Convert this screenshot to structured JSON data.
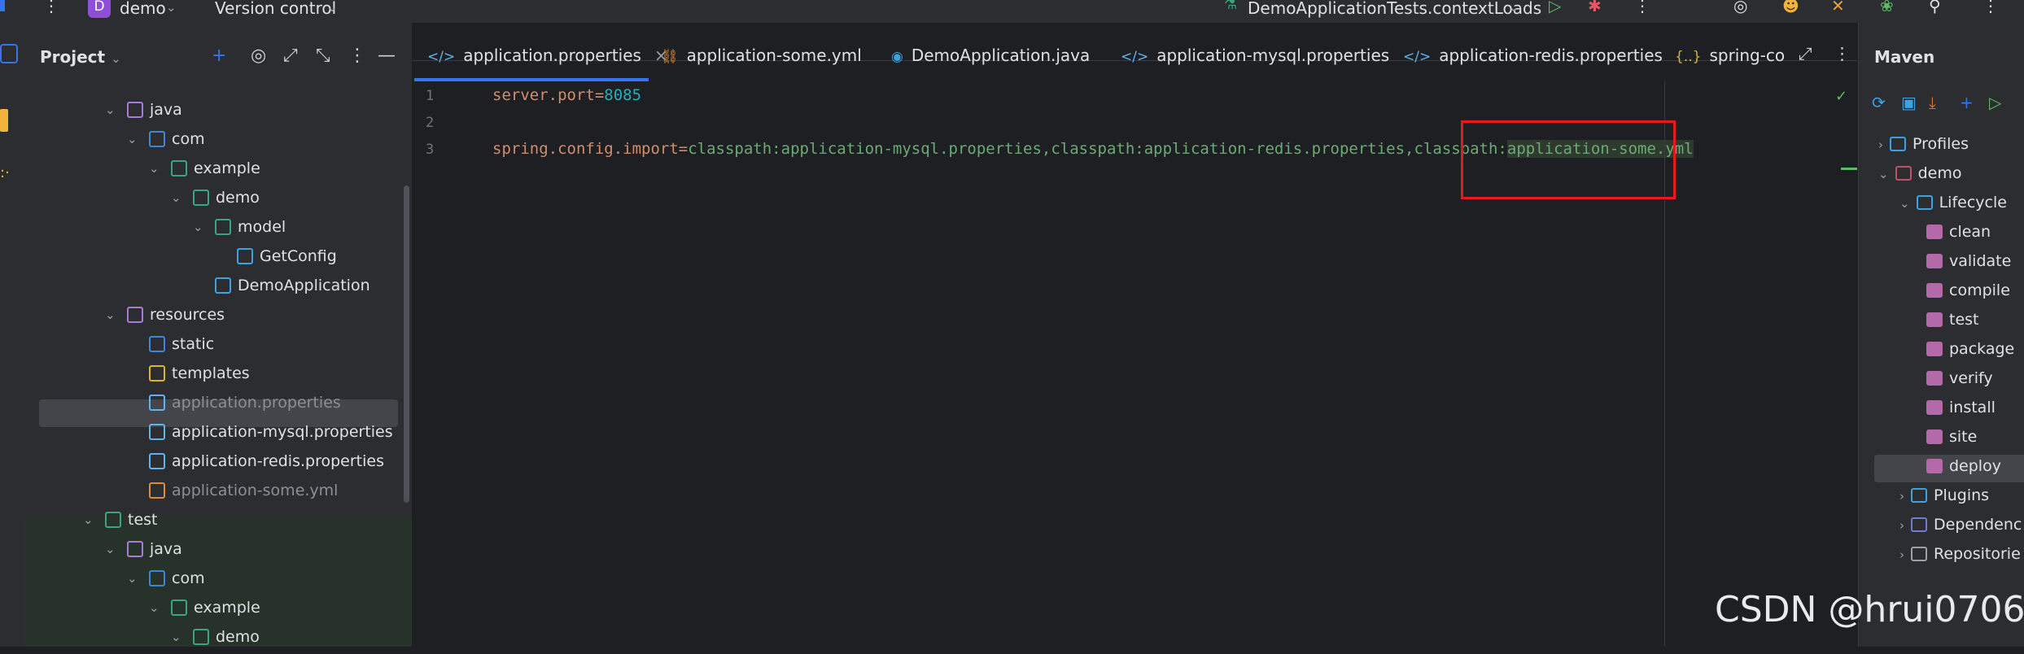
{
  "topbar": {
    "project_badge": "D",
    "project_name": "demo",
    "vcs_label": "Version control",
    "run_config": "DemoApplicationTests.contextLoads"
  },
  "project_panel": {
    "title": "Project",
    "tree": [
      {
        "label": "java",
        "depth": 3,
        "chev": "v",
        "icon": "source-folder-icon",
        "color": "#a97bd7"
      },
      {
        "label": "com",
        "depth": 4,
        "chev": "v",
        "icon": "package-folder-icon",
        "color": "#3e86d6"
      },
      {
        "label": "example",
        "depth": 5,
        "chev": "v",
        "icon": "package-icon",
        "color": "#3ba57c"
      },
      {
        "label": "demo",
        "depth": 6,
        "chev": "v",
        "icon": "package-icon",
        "color": "#3ba57c"
      },
      {
        "label": "model",
        "depth": 7,
        "chev": "v",
        "icon": "package-icon",
        "color": "#3ba57c"
      },
      {
        "label": "GetConfig",
        "depth": 8,
        "chev": "",
        "icon": "class-icon",
        "color": "#3ea1e0"
      },
      {
        "label": "DemoApplication",
        "depth": 7,
        "chev": "",
        "icon": "spring-class-icon",
        "color": "#3ea1e0"
      },
      {
        "label": "resources",
        "depth": 3,
        "chev": "v",
        "icon": "resources-folder-icon",
        "color": "#a97bd7"
      },
      {
        "label": "static",
        "depth": 4,
        "chev": "",
        "icon": "web-folder-icon",
        "color": "#3e86d6"
      },
      {
        "label": "templates",
        "depth": 4,
        "chev": "",
        "icon": "folder-icon",
        "color": "#e0b030"
      },
      {
        "label": "application.properties",
        "depth": 4,
        "chev": "",
        "icon": "properties-icon",
        "color": "#5fb3f0",
        "dim": true
      },
      {
        "label": "application-mysql.properties",
        "depth": 4,
        "chev": "",
        "icon": "properties-icon",
        "color": "#5fb3f0"
      },
      {
        "label": "application-redis.properties",
        "depth": 4,
        "chev": "",
        "icon": "properties-icon",
        "color": "#5fb3f0"
      },
      {
        "label": "application-some.yml",
        "depth": 4,
        "chev": "",
        "icon": "yaml-icon",
        "color": "#e08b3a",
        "dim": true
      },
      {
        "label": "test",
        "depth": 2,
        "chev": "v",
        "icon": "test-folder-icon",
        "color": "#3ba57c"
      },
      {
        "label": "java",
        "depth": 3,
        "chev": "v",
        "icon": "test-source-folder-icon",
        "color": "#a97bd7"
      },
      {
        "label": "com",
        "depth": 4,
        "chev": "v",
        "icon": "package-folder-icon",
        "color": "#3e86d6"
      },
      {
        "label": "example",
        "depth": 5,
        "chev": "v",
        "icon": "package-icon",
        "color": "#3ba57c"
      },
      {
        "label": "demo",
        "depth": 6,
        "chev": "v",
        "icon": "package-icon",
        "color": "#3ba57c"
      }
    ]
  },
  "editor": {
    "tabs": [
      {
        "label": "application.properties",
        "icon": "</>",
        "closable": "×"
      },
      {
        "label": "application-some.yml",
        "icon": "⛓"
      },
      {
        "label": "DemoApplication.java",
        "icon": "◉"
      },
      {
        "label": "application-mysql.properties",
        "icon": "</>"
      },
      {
        "label": "application-redis.properties",
        "icon": "</>"
      },
      {
        "label": "spring-co",
        "icon": "{..}"
      }
    ],
    "line_numbers": [
      "1",
      "2",
      "3"
    ],
    "line1_key": "server.port",
    "line1_eq": "=",
    "line1_val": "8085",
    "line3_key": "spring.config.import",
    "line3_eq": "=",
    "line3_val_a": "classpath:application-mysql.properties,classpath:application-redis.properties,classpath:",
    "line3_val_b": "application-some.yml"
  },
  "maven": {
    "title": "Maven",
    "profiles": "Profiles",
    "project": "demo",
    "lifecycle": "Lifecycle",
    "goals": [
      "clean",
      "validate",
      "compile",
      "test",
      "package",
      "verify",
      "install",
      "site",
      "deploy"
    ],
    "plugins": "Plugins",
    "dependencies": "Dependenc",
    "repositories": "Repositorie"
  },
  "watermark": "CSDN @hrui0706",
  "colors": {
    "accent": "#3574f0",
    "highlight_box": "#e5191e",
    "keyword": "#cf8e6d",
    "number": "#2aacb8",
    "string": "#6aab73"
  }
}
